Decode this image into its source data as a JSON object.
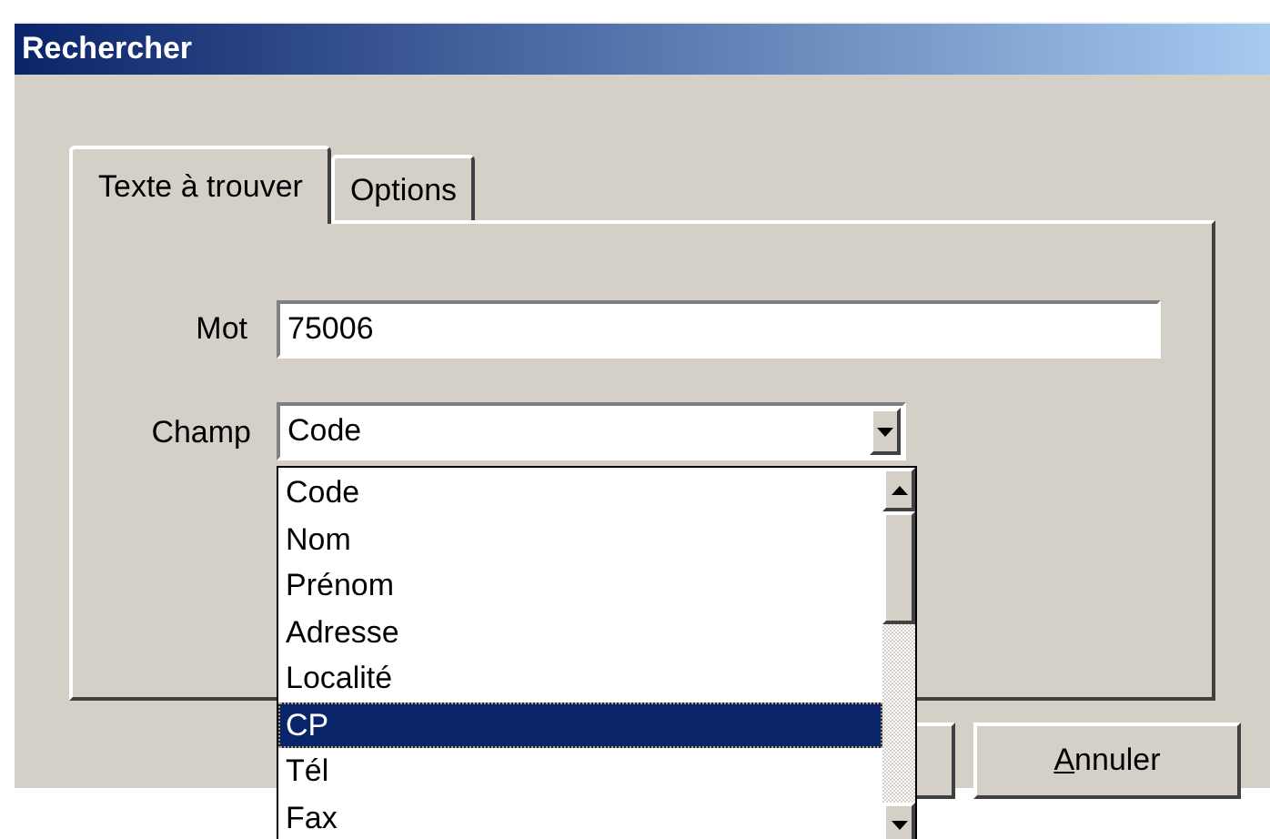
{
  "window": {
    "title": "Rechercher"
  },
  "tabs": [
    {
      "label": "Texte à trouver",
      "selected": true
    },
    {
      "label": "Options",
      "selected": false
    }
  ],
  "fields": {
    "word": {
      "label": "Mot",
      "value": "75006"
    },
    "field": {
      "label": "Champ",
      "value": "Code",
      "expanded": true
    }
  },
  "dropdown_items": [
    {
      "label": "Code",
      "selected": false
    },
    {
      "label": "Nom",
      "selected": false
    },
    {
      "label": "Prénom",
      "selected": false
    },
    {
      "label": "Adresse",
      "selected": false
    },
    {
      "label": "Localité",
      "selected": false
    },
    {
      "label": "CP",
      "selected": true
    },
    {
      "label": "Tél",
      "selected": false
    },
    {
      "label": "Fax",
      "selected": false
    }
  ],
  "buttons": [
    {
      "label": "Annuler",
      "underline_first": true
    }
  ]
}
